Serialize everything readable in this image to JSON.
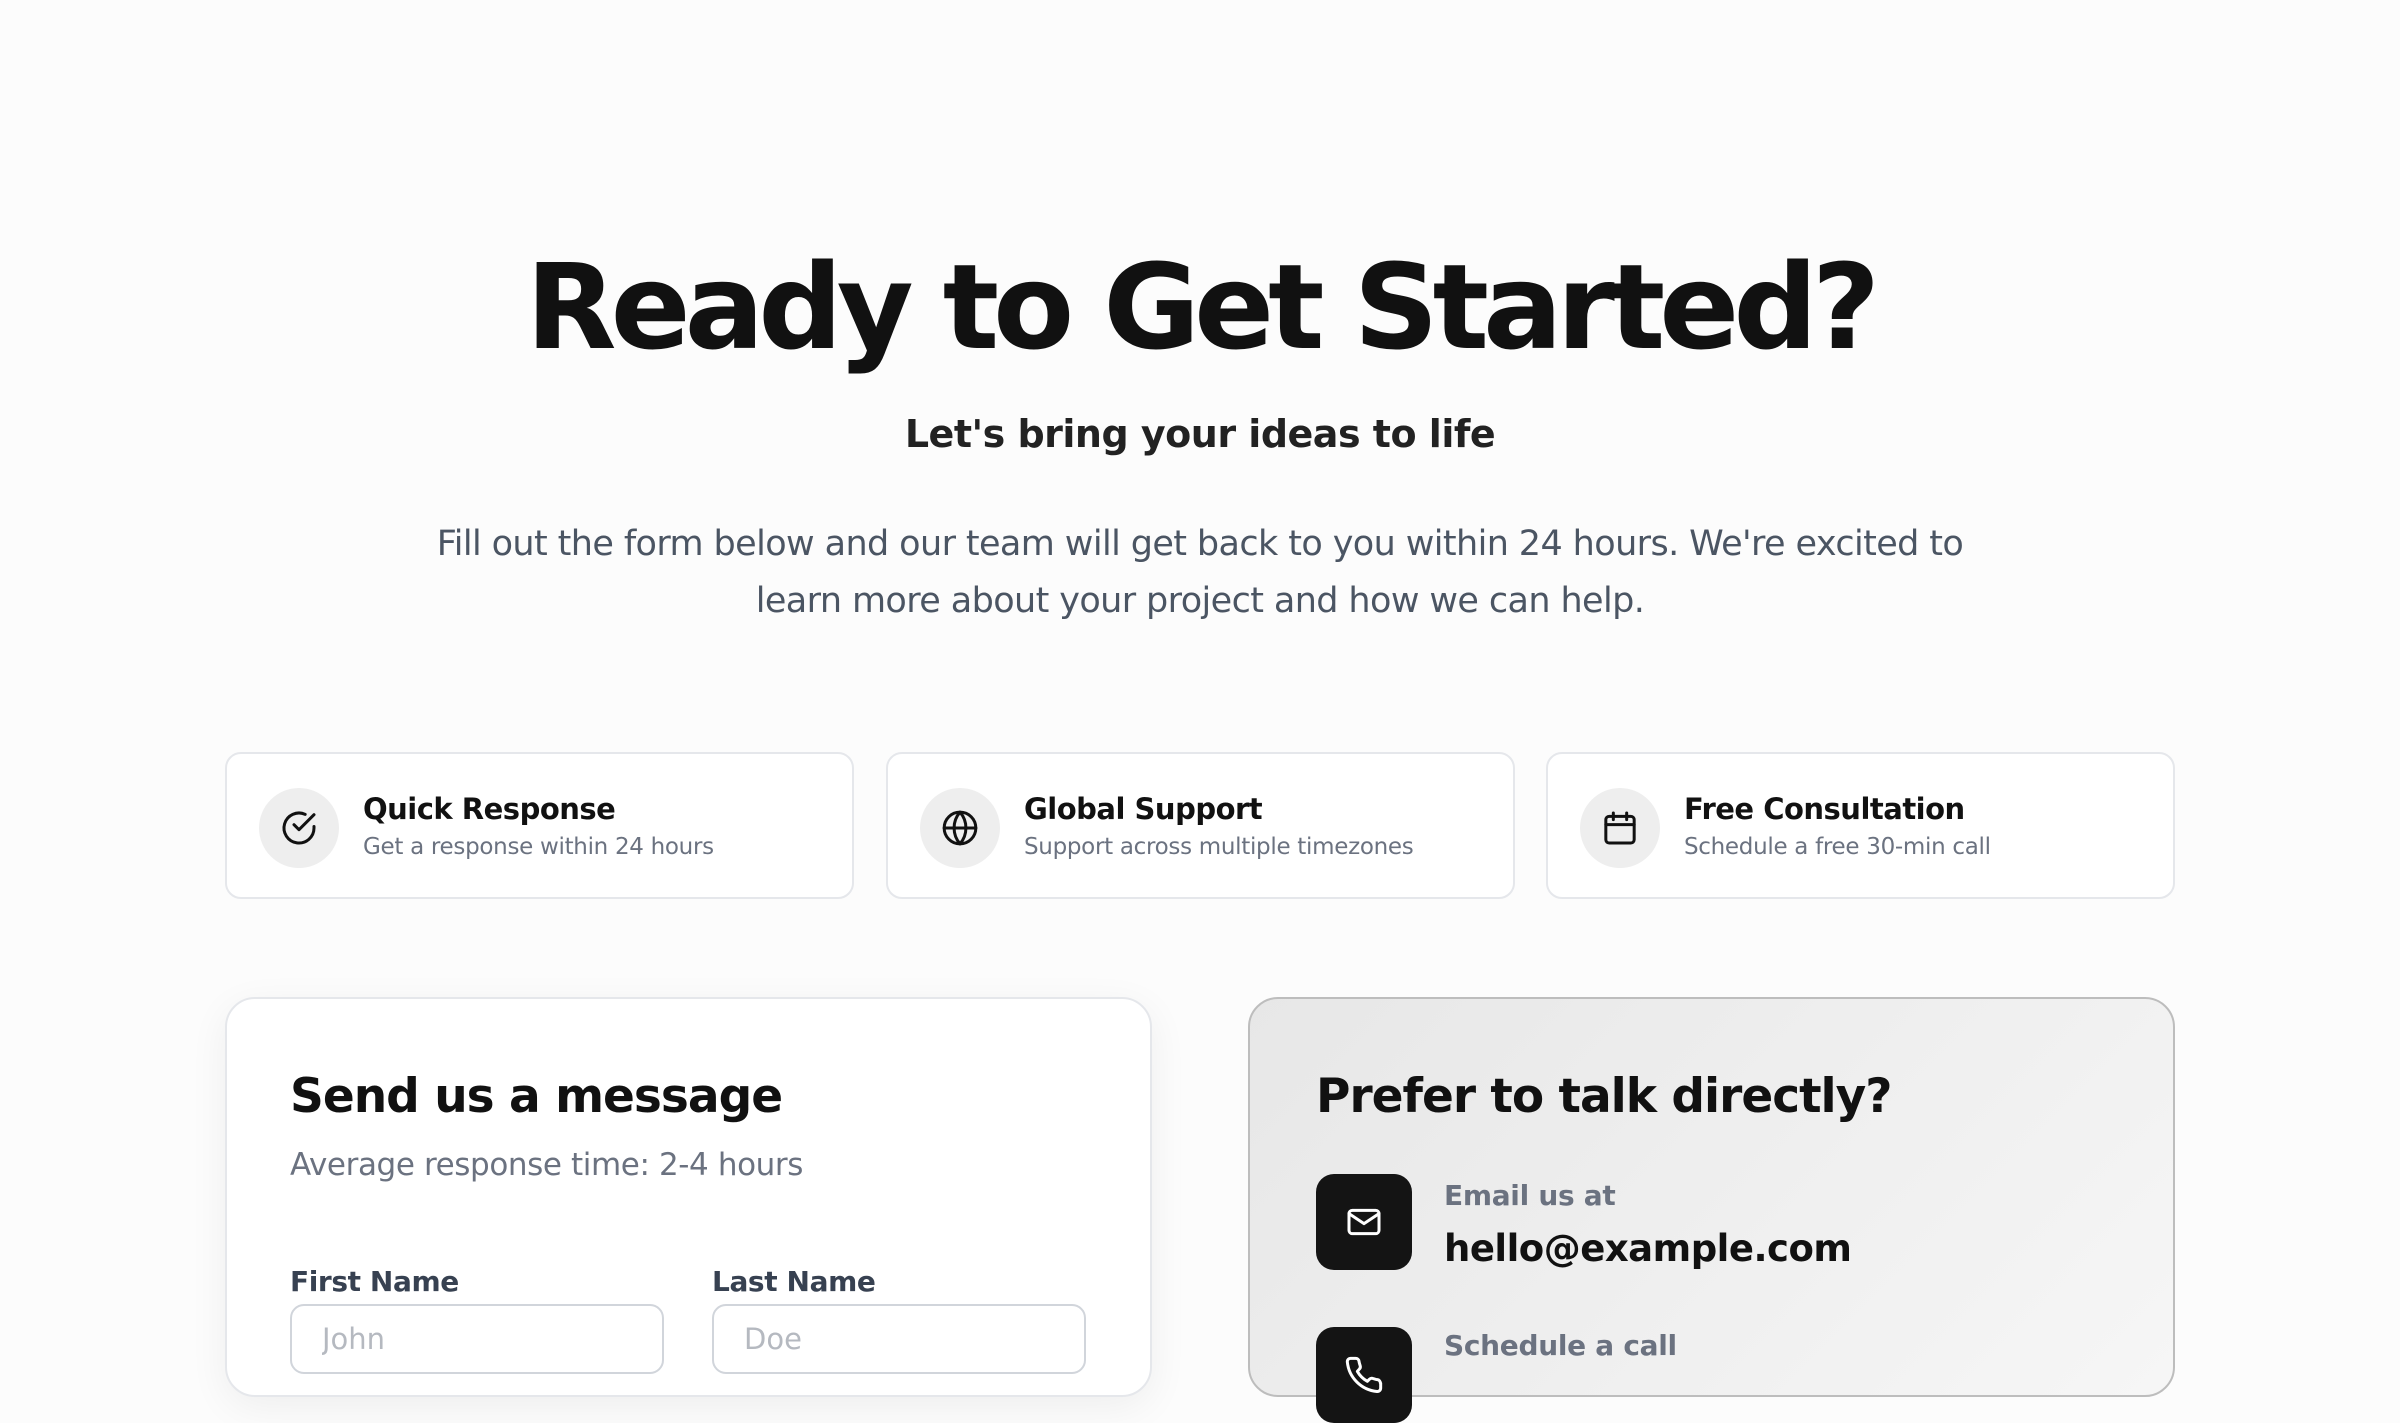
{
  "hero": {
    "title": "Ready to Get Started?",
    "subtitle": "Let's bring your ideas to life",
    "description": "Fill out the form below and our team will get back to you within 24 hours. We're excited to learn more about your project and how we can help."
  },
  "features": [
    {
      "icon": "check-circle-icon",
      "title": "Quick Response",
      "description": "Get a response within 24 hours"
    },
    {
      "icon": "globe-icon",
      "title": "Global Support",
      "description": "Support across multiple timezones"
    },
    {
      "icon": "calendar-icon",
      "title": "Free Consultation",
      "description": "Schedule a free 30-min call"
    }
  ],
  "form": {
    "title": "Send us a message",
    "subtitle": "Average response time: 2-4 hours",
    "first_name": {
      "label": "First Name",
      "placeholder": "John",
      "value": ""
    },
    "last_name": {
      "label": "Last Name",
      "placeholder": "Doe",
      "value": ""
    }
  },
  "contact": {
    "title": "Prefer to talk directly?",
    "email": {
      "icon": "mail-icon",
      "label": "Email us at",
      "value": "hello@example.com"
    },
    "call": {
      "icon": "phone-icon",
      "label": "Schedule a call"
    }
  },
  "colors": {
    "background": "#fcfcfc",
    "text_primary": "#111111",
    "text_muted": "#6b7280",
    "icon_tile": "#141414"
  }
}
